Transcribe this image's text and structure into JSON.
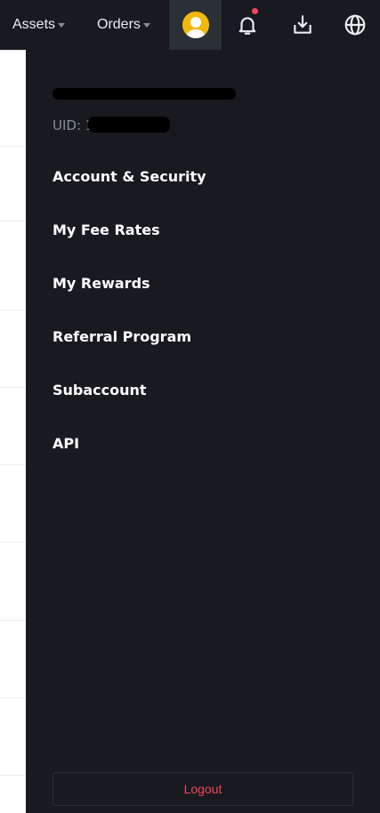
{
  "header": {
    "assets_label": "Assets",
    "orders_label": "Orders"
  },
  "icons": {
    "avatar": "user-avatar",
    "notifications": "bell-icon",
    "download": "download-icon",
    "language": "globe-icon"
  },
  "account": {
    "username": "",
    "uid_label": "UID: 1"
  },
  "menu": {
    "items": [
      {
        "label": "Account & Security"
      },
      {
        "label": "My Fee Rates"
      },
      {
        "label": "My Rewards"
      },
      {
        "label": "Referral Program"
      },
      {
        "label": "Subaccount"
      },
      {
        "label": "API"
      }
    ]
  },
  "footer": {
    "logout_label": "Logout"
  },
  "colors": {
    "background": "#181a20",
    "accent": "#f0b90b",
    "danger": "#f6465d",
    "text": "#eaecef",
    "muted": "#848e9c"
  }
}
